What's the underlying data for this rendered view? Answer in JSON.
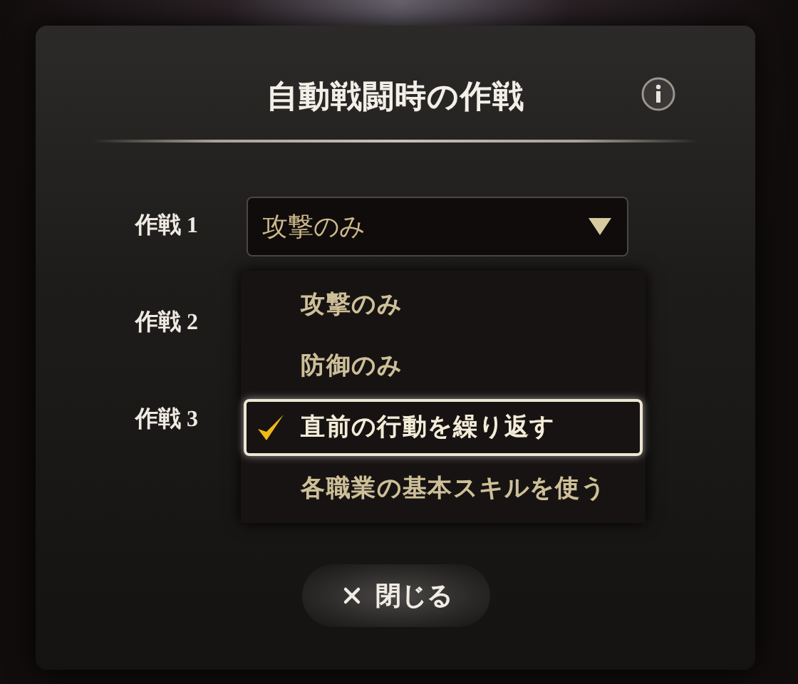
{
  "dialog": {
    "title": "自動戦闘時の作戦",
    "tactics": [
      {
        "label": "作戦 1",
        "value": "攻撃のみ"
      },
      {
        "label": "作戦 2"
      },
      {
        "label": "作戦 3"
      }
    ],
    "menu": {
      "options": [
        {
          "label": "攻撃のみ",
          "selected": false
        },
        {
          "label": "防御のみ",
          "selected": false
        },
        {
          "label": "直前の行動を繰り返す",
          "selected": true
        },
        {
          "label": "各職業の基本スキルを使う",
          "selected": false
        }
      ]
    },
    "close_button": {
      "label": "閉じる"
    }
  }
}
